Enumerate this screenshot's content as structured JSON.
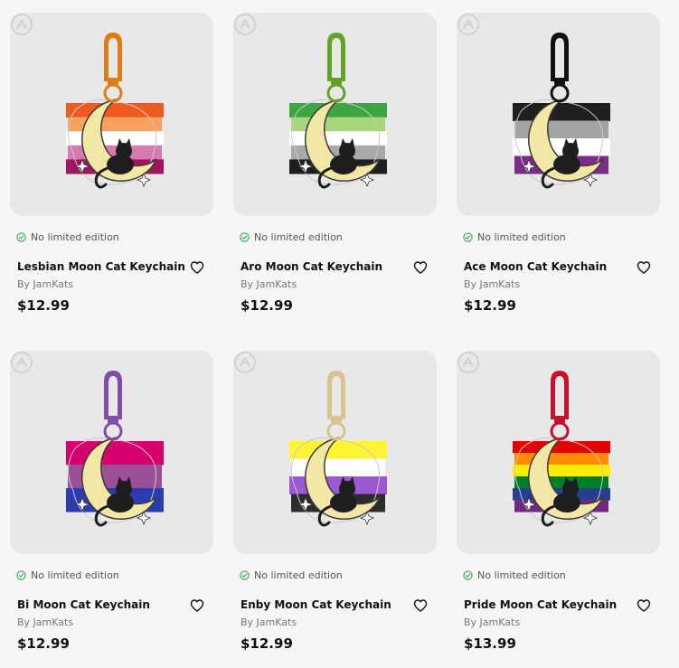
{
  "products": [
    {
      "name": "Lesbian Moon Cat Keychain",
      "edition": "No limited edition",
      "seller": "By JamKats",
      "price": "$12.99",
      "image_alt": "Lesbian Moon Cat Keychain",
      "clasp_color": "#e07d12",
      "flag_colors": [
        "#ef5a1e",
        "#f6a25e",
        "#ffffff",
        "#d67ab0",
        "#a1155e"
      ]
    },
    {
      "name": "Aro Moon Cat Keychain",
      "edition": "No limited edition",
      "seller": "By JamKats",
      "price": "$12.99",
      "image_alt": "Aro Moon Cat Keychain",
      "clasp_color": "#63a324",
      "flag_colors": [
        "#3da542",
        "#a8d47a",
        "#ffffff",
        "#a9a9a9",
        "#1f1f1f"
      ]
    },
    {
      "name": "Ace Moon Cat Keychain",
      "edition": "No limited edition",
      "seller": "By JamKats",
      "price": "$12.99",
      "image_alt": "Ace Moon Cat Keychain",
      "clasp_color": "#111111",
      "flag_colors": [
        "#1f1f1f",
        "#a3a3a3",
        "#ffffff",
        "#7d2c87"
      ]
    },
    {
      "name": "Bi Moon Cat Keychain",
      "edition": "No limited edition",
      "seller": "By JamKats",
      "price": "$12.99",
      "image_alt": "Bi Moon Cat Keychain",
      "clasp_color": "#7f4ea6",
      "flag_colors": [
        "#d6006e",
        "#9b4f96",
        "#2a3cb0"
      ]
    },
    {
      "name": "Enby Moon Cat Keychain",
      "edition": "No limited edition",
      "seller": "By JamKats",
      "price": "$12.99",
      "image_alt": "Enby Moon Cat Keychain",
      "clasp_color": "#d9c48e",
      "flag_colors": [
        "#fcf434",
        "#ffffff",
        "#9c59d1",
        "#2c2c2c"
      ]
    },
    {
      "name": "Pride Moon Cat Keychain",
      "edition": "No limited edition",
      "seller": "By JamKats",
      "price": "$13.99",
      "image_alt": "Pride Moon Cat Keychain",
      "clasp_color": "#c8102e",
      "flag_colors": [
        "#e40303",
        "#ff8c00",
        "#ffed00",
        "#008026",
        "#24408e",
        "#732982"
      ]
    }
  ],
  "icons": {
    "favorite": "heart-outline-icon",
    "edition": "check-circle-icon",
    "badge": "brand-badge-icon"
  },
  "colors": {
    "page_bg": "#f6f6f6",
    "card_bg": "#e8e8e8",
    "check": "#3aa655",
    "text_muted": "#777777"
  }
}
